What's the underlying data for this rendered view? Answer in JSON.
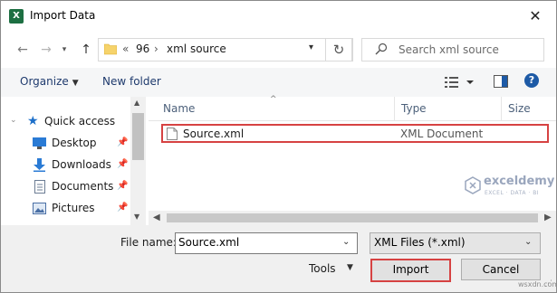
{
  "window": {
    "title": "Import Data",
    "app_icon": "X"
  },
  "address": {
    "overflow": "«",
    "crumbs": [
      "96",
      "xml source"
    ],
    "search_placeholder": "Search xml source"
  },
  "toolbar": {
    "organize": "Organize",
    "new_folder": "New folder"
  },
  "nav": {
    "items": [
      {
        "label": "Quick access"
      },
      {
        "label": "Desktop"
      },
      {
        "label": "Downloads"
      },
      {
        "label": "Documents"
      },
      {
        "label": "Pictures"
      }
    ]
  },
  "columns": {
    "name": "Name",
    "type": "Type",
    "size": "Size"
  },
  "files": [
    {
      "name": "Source.xml",
      "type": "XML Document"
    }
  ],
  "watermark": {
    "brand": "exceldemy",
    "tagline": "EXCEL · DATA · BI"
  },
  "bottom": {
    "file_name_label": "File name:",
    "file_name_value": "Source.xml",
    "file_type_value": "XML Files (*.xml)",
    "tools": "Tools",
    "import": "Import",
    "cancel": "Cancel"
  },
  "site_mark": "wsxdn.com",
  "colors": {
    "highlight": "#d64242",
    "accent": "#1d5aa6",
    "excel_green": "#1d6f42"
  }
}
